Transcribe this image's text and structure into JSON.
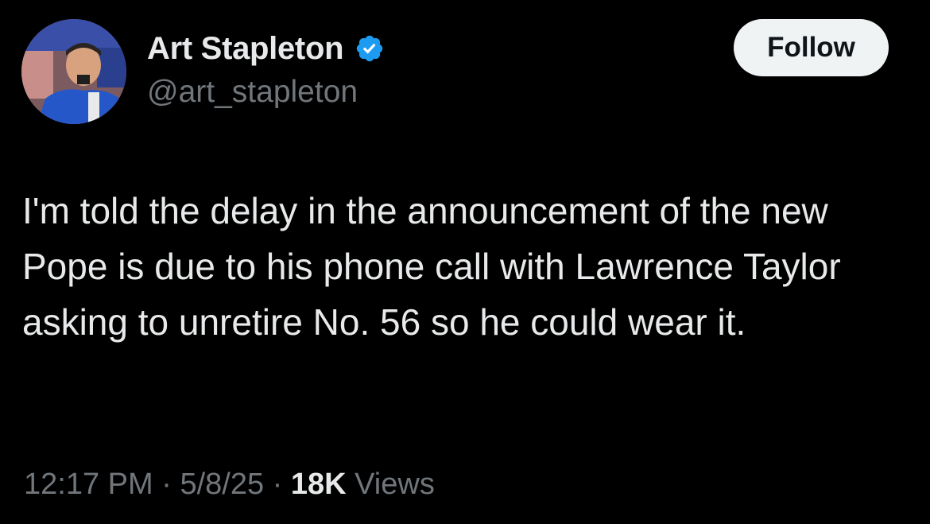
{
  "author": {
    "display_name": "Art Stapleton",
    "handle": "@art_stapleton",
    "verified": true,
    "verified_color": "#1d9bf0",
    "avatar_icon": "profile-photo"
  },
  "follow_button": {
    "label": "Follow"
  },
  "tweet": {
    "text": "I'm told the delay in the announcement of the new Pope is due to his phone call with Lawrence Taylor asking to unretire No. 56 so he could wear it."
  },
  "meta": {
    "time": "12:17 PM",
    "separator": " · ",
    "date": "5/8/25",
    "views_count": "18K",
    "views_label": " Views"
  },
  "colors": {
    "background": "#000000",
    "primary_text": "#e7e9ea",
    "secondary_text": "#71767b",
    "button_bg": "#eff3f4"
  }
}
